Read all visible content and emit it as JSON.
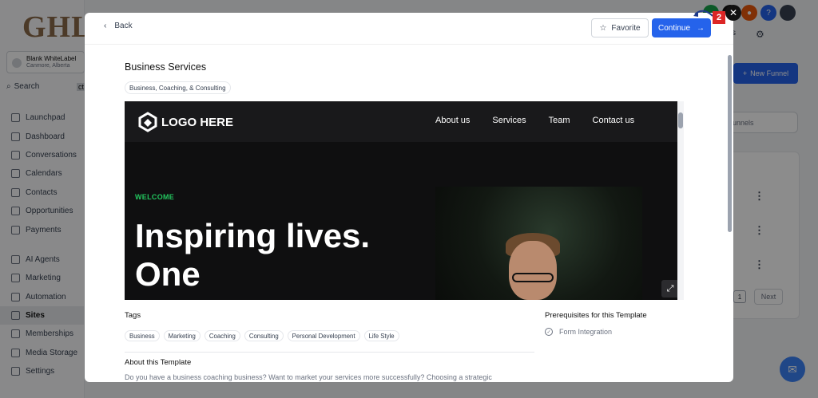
{
  "app": {
    "logo": "GHL",
    "account_name": "Blank WhiteLabel",
    "account_location": "Canmore, Alberta",
    "search_label": "Search",
    "search_shortcut": "ct",
    "nav_primary": [
      "Launchpad",
      "Dashboard",
      "Conversations",
      "Calendars",
      "Contacts",
      "Opportunities",
      "Payments"
    ],
    "nav_secondary": [
      "AI Agents",
      "Marketing",
      "Automation",
      "Sites",
      "Memberships",
      "Media Storage",
      "Settings"
    ],
    "active_item": "Sites",
    "new_funnel_label": "New Funnel",
    "funnels_placeholder": "unnels",
    "next_label": "Next",
    "page_number": "1",
    "top_right_s": "s"
  },
  "modal": {
    "back_label": "Back",
    "favorite_label": "Favorite",
    "continue_label": "Continue",
    "title": "Business Services",
    "category": "Business, Coaching, & Consulting",
    "preview": {
      "logo_text": "LOGO HERE",
      "nav_links": [
        "About us",
        "Services",
        "Team",
        "Contact us"
      ],
      "welcome": "WELCOME",
      "hero_text": "Inspiring lives. One"
    },
    "tags_heading": "Tags",
    "tags": [
      "Business",
      "Marketing",
      "Coaching",
      "Consulting",
      "Personal Development",
      "Life Style"
    ],
    "prereq_heading": "Prerequisites for this Template",
    "prereq_item": "Form Integration",
    "about_heading": "About this Template",
    "about_text": "Do you have a business coaching business? Want to market your services more successfully? Choosing a strategic"
  },
  "annotation": {
    "step": "2"
  },
  "colors": {
    "primary": "#2563eb",
    "welcome_green": "#22c55e",
    "badge_red": "#dc2626"
  }
}
